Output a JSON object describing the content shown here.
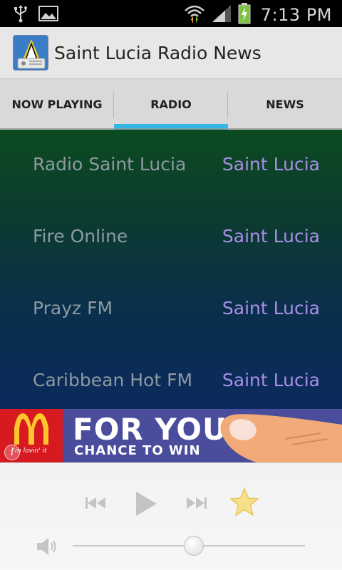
{
  "status_bar": {
    "time": "7:13 PM",
    "icons": [
      "usb-icon",
      "image-icon",
      "wifi-icon",
      "signal-icon",
      "battery-charging-icon"
    ]
  },
  "action_bar": {
    "title": "Saint Lucia Radio News"
  },
  "tabs": [
    {
      "label": "NOW PLAYING",
      "active": false
    },
    {
      "label": "RADIO",
      "active": true
    },
    {
      "label": "NEWS",
      "active": false
    }
  ],
  "stations": [
    {
      "name": "Radio Saint Lucia",
      "country": "Saint Lucia"
    },
    {
      "name": "Fire Online",
      "country": "Saint Lucia"
    },
    {
      "name": "Prayz FM",
      "country": "Saint Lucia"
    },
    {
      "name": "Caribbean Hot FM",
      "country": "Saint Lucia"
    }
  ],
  "ad": {
    "slogan": "i'm lovin' it",
    "headline": "FOR YOUR",
    "subline": "CHANCE TO WIN"
  },
  "player": {
    "volume": 0.52,
    "icons": [
      "previous-icon",
      "play-icon",
      "next-icon",
      "favorite-star-icon",
      "volume-icon"
    ]
  },
  "colors": {
    "accent": "#33b5e5",
    "station_name": "#8e9aa2",
    "station_country": "#a98ee6",
    "ad_background": "#4a4d9c",
    "mcdonalds_red": "#d71920"
  }
}
